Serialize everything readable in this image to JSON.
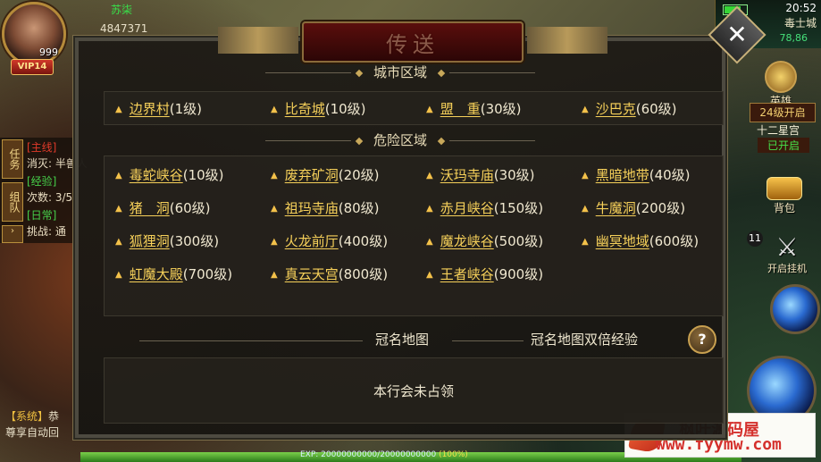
{
  "hud": {
    "player_level": "999",
    "vip": "VIP14",
    "player_name": "苏柒",
    "power": "4847371",
    "clock": "20:52",
    "map_name": "毒士城",
    "coords": "78,86",
    "quest_tabs": [
      "任务",
      "组队"
    ],
    "quests": [
      {
        "tag": "[主线]",
        "text": "消灭: 半兽人"
      },
      {
        "tag": "[经验]",
        "text": "次数: 3/5"
      },
      {
        "tag": "[日常]",
        "text": "挑战: 通"
      }
    ],
    "side_buttons": {
      "hero": "英雄",
      "level_unlock": "24级开启",
      "twelve_zodiac": "十二星宫",
      "opened": "已开启",
      "bag": "背包",
      "auto_fight": "开启挂机",
      "badge_count": "11"
    },
    "system_chat": {
      "tag": "【系统】",
      "line1": "恭",
      "line2": "尊享自动回"
    },
    "exp_text": "EXP: 20000000000/20000000000",
    "exp_pct": "(100%)",
    "exp_fraction": 1.0
  },
  "dialog": {
    "title": "传送",
    "close_label": "✕",
    "city_section": "城市区域",
    "danger_section": "危险区域",
    "city_locations": [
      {
        "name": "边界村",
        "level": "(1级)"
      },
      {
        "name": "比奇城",
        "level": "(10级)"
      },
      {
        "name": "盟　重",
        "level": "(30级)"
      },
      {
        "name": "沙巴克",
        "level": "(60级)"
      }
    ],
    "danger_locations": [
      {
        "name": "毒蛇峡谷",
        "level": "(10级)"
      },
      {
        "name": "废弃矿洞",
        "level": "(20级)"
      },
      {
        "name": "沃玛寺庙",
        "level": "(30级)"
      },
      {
        "name": "黑暗地带",
        "level": "(40级)"
      },
      {
        "name": "猪　洞",
        "level": "(60级)"
      },
      {
        "name": "祖玛寺庙",
        "level": "(80级)"
      },
      {
        "name": "赤月峡谷",
        "level": "(150级)"
      },
      {
        "name": "牛魔洞",
        "level": "(200级)"
      },
      {
        "name": "狐狸洞",
        "level": "(300级)"
      },
      {
        "name": "火龙前厅",
        "level": "(400级)"
      },
      {
        "name": "魔龙峡谷",
        "level": "(500级)"
      },
      {
        "name": "幽冥地域",
        "level": "(600级)"
      },
      {
        "name": "虹魔大殿",
        "level": "(700级)"
      },
      {
        "name": "真云天宫",
        "level": "(800级)"
      },
      {
        "name": "王者峡谷",
        "level": "(900级)"
      }
    ],
    "crown_map_label": "冠名地图",
    "crown_double_exp": "冠名地图双倍经验",
    "help_label": "?",
    "status": "本行会未占领"
  },
  "watermark": {
    "line1": "枫叶源码屋",
    "line2": "www.fyymw.com"
  }
}
